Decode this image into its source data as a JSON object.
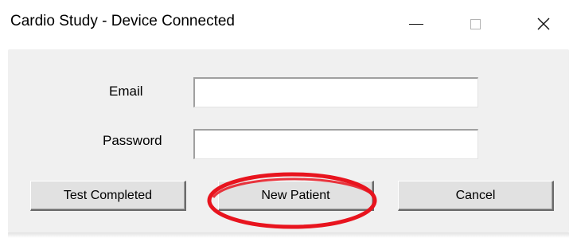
{
  "window": {
    "title": "Cardio Study - Device Connected",
    "controls": {
      "minimize_icon": "minimize-icon",
      "maximize_icon": "maximize-icon",
      "close_icon": "close-icon",
      "close_glyph": "✕"
    }
  },
  "form": {
    "email_label": "Email",
    "email_value": "",
    "password_label": "Password",
    "password_value": ""
  },
  "buttons": {
    "test_completed": "Test Completed",
    "new_patient": "New Patient",
    "cancel": "Cancel"
  },
  "colors": {
    "dialog_background": "#f0f0f0",
    "annotation_red": "#e8141e"
  }
}
